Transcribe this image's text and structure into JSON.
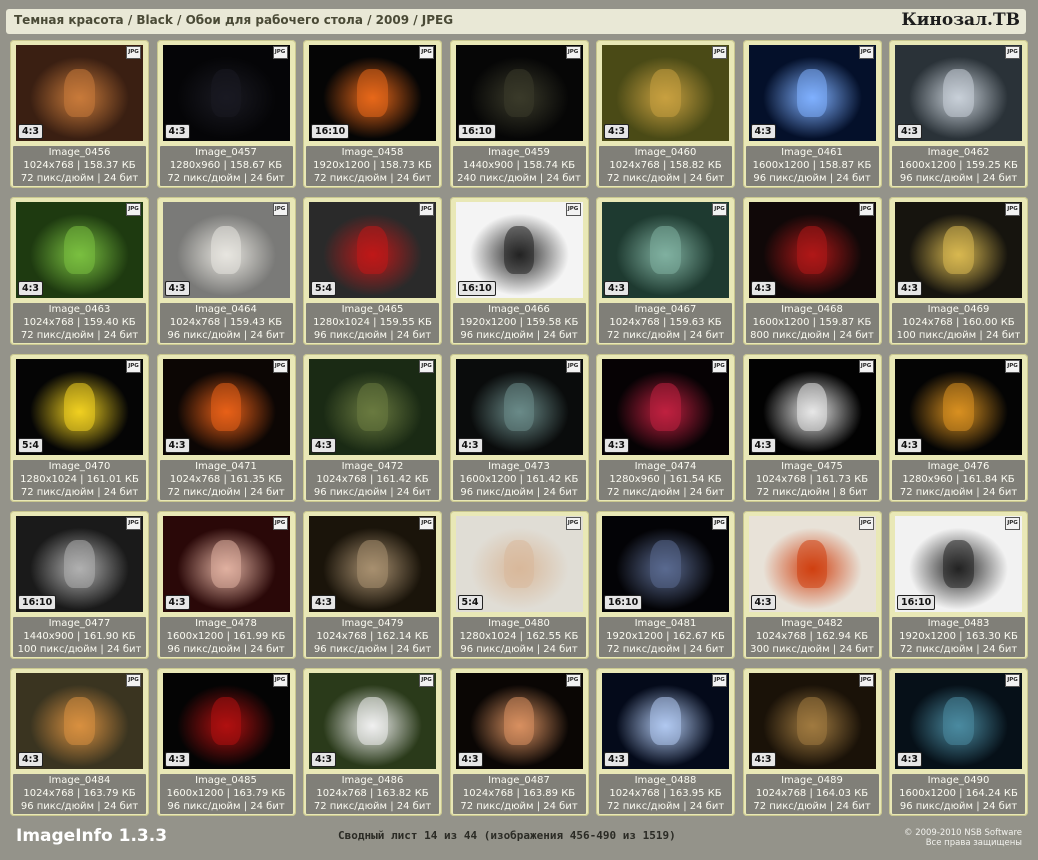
{
  "header": {
    "breadcrumb": "Темная красота / Black / Обои для рабочего стола / 2009 / JPEG",
    "logo": "Кинозал.ТВ"
  },
  "cards": [
    {
      "ratio": "4:3",
      "name": "Image_0456",
      "line2": "1024x768 | 158.37 КБ",
      "line3": "72 пикс/дюйм | 24 бит",
      "tone": "#3a1f12",
      "accent": "#c87a3a",
      "icon": "portrait"
    },
    {
      "ratio": "4:3",
      "name": "Image_0457",
      "line2": "1280x960 | 158.67 КБ",
      "line3": "72 пикс/дюйм | 24 бит",
      "tone": "#050507",
      "accent": "#1a1a22",
      "icon": "car-dark"
    },
    {
      "ratio": "16:10",
      "name": "Image_0458",
      "line2": "1920x1200 | 158.73 КБ",
      "line3": "72 пикс/дюйм | 24 бит",
      "tone": "#050505",
      "accent": "#e8681a",
      "icon": "pumpkins"
    },
    {
      "ratio": "16:10",
      "name": "Image_0459",
      "line2": "1440x900 | 158.74 КБ",
      "line3": "240 пикс/дюйм | 24 бит",
      "tone": "#060606",
      "accent": "#3a3a2a",
      "icon": "panther"
    },
    {
      "ratio": "4:3",
      "name": "Image_0460",
      "line2": "1024x768 | 158.82 КБ",
      "line3": "72 пикс/дюйм | 24 бит",
      "tone": "#4a4a16",
      "accent": "#c8a040",
      "icon": "fantasy"
    },
    {
      "ratio": "4:3",
      "name": "Image_0461",
      "line2": "1600x1200 | 158.87 КБ",
      "line3": "96 пикс/дюйм | 24 бит",
      "tone": "#04102a",
      "accent": "#7fb0ff",
      "icon": "planet"
    },
    {
      "ratio": "4:3",
      "name": "Image_0462",
      "line2": "1600x1200 | 159.25 КБ",
      "line3": "96 пикс/дюйм | 24 бит",
      "tone": "#2a3238",
      "accent": "#c8d0d8",
      "icon": "chess"
    },
    {
      "ratio": "4:3",
      "name": "Image_0463",
      "line2": "1024x768 | 159.40 КБ",
      "line3": "72 пикс/дюйм | 24 бит",
      "tone": "#1e3a10",
      "accent": "#7ac040",
      "icon": "demon"
    },
    {
      "ratio": "4:3",
      "name": "Image_0464",
      "line2": "1024x768 | 159.43 КБ",
      "line3": "96 пикс/дюйм | 24 бит",
      "tone": "#7a7a78",
      "accent": "#e8e6e0",
      "icon": "car-white"
    },
    {
      "ratio": "5:4",
      "name": "Image_0465",
      "line2": "1280x1024 | 159.55 КБ",
      "line3": "96 пикс/дюйм | 24 бит",
      "tone": "#2a2a2a",
      "accent": "#c01818",
      "icon": "woman-red"
    },
    {
      "ratio": "16:10",
      "name": "Image_0466",
      "line2": "1920x1200 | 159.58 КБ",
      "line3": "96 пикс/дюйм | 24 бит",
      "tone": "#f4f4f4",
      "accent": "#222222",
      "icon": "face",
      "light": true
    },
    {
      "ratio": "4:3",
      "name": "Image_0467",
      "line2": "1024x768 | 159.63 КБ",
      "line3": "72 пикс/дюйм | 24 бит",
      "tone": "#1e3a30",
      "accent": "#80b0a0",
      "icon": "helicopter"
    },
    {
      "ratio": "4:3",
      "name": "Image_0468",
      "line2": "1600x1200 | 159.87 КБ",
      "line3": "800 пикс/дюйм | 24 бит",
      "tone": "#100808",
      "accent": "#b01818",
      "icon": "fantasy-red"
    },
    {
      "ratio": "4:3",
      "name": "Image_0469",
      "line2": "1024x768 | 160.00 КБ",
      "line3": "100 пикс/дюйм | 24 бит",
      "tone": "#16140e",
      "accent": "#d8b850",
      "icon": "spaceship"
    },
    {
      "ratio": "5:4",
      "name": "Image_0470",
      "line2": "1280x1024 | 161.01 КБ",
      "line3": "72 пикс/дюйм | 24 бит",
      "tone": "#050505",
      "accent": "#f0d020",
      "icon": "robot"
    },
    {
      "ratio": "4:3",
      "name": "Image_0471",
      "line2": "1024x768 | 161.35 КБ",
      "line3": "72 пикс/дюйм | 24 бит",
      "tone": "#0c0604",
      "accent": "#e86018",
      "icon": "explosion"
    },
    {
      "ratio": "4:3",
      "name": "Image_0472",
      "line2": "1024x768 | 161.42 КБ",
      "line3": "96 пикс/дюйм | 24 бит",
      "tone": "#1a2a14",
      "accent": "#6a7a40",
      "icon": "monkeys"
    },
    {
      "ratio": "4:3",
      "name": "Image_0473",
      "line2": "1600x1200 | 161.42 КБ",
      "line3": "96 пикс/дюйм | 24 бит",
      "tone": "#0a0c0c",
      "accent": "#6a8a88",
      "icon": "creature"
    },
    {
      "ratio": "4:3",
      "name": "Image_0474",
      "line2": "1280x960 | 161.54 КБ",
      "line3": "72 пикс/дюйм | 24 бит",
      "tone": "#060204",
      "accent": "#c02040",
      "icon": "fairy-red"
    },
    {
      "ratio": "4:3",
      "name": "Image_0475",
      "line2": "1024x768 | 161.73 КБ",
      "line3": "72 пикс/дюйм | 8 бит",
      "tone": "#020202",
      "accent": "#e8e8e8",
      "icon": "emblem"
    },
    {
      "ratio": "4:3",
      "name": "Image_0476",
      "line2": "1280x960 | 161.84 КБ",
      "line3": "72 пикс/дюйм | 24 бит",
      "tone": "#040404",
      "accent": "#d89020",
      "icon": "dragonfly"
    },
    {
      "ratio": "16:10",
      "name": "Image_0477",
      "line2": "1440x900 | 161.90 КБ",
      "line3": "100 пикс/дюйм | 24 бит",
      "tone": "#1a1a1a",
      "accent": "#b0b0b0",
      "icon": "letter-x"
    },
    {
      "ratio": "4:3",
      "name": "Image_0478",
      "line2": "1600x1200 | 161.99 КБ",
      "line3": "96 пикс/дюйм | 24 бит",
      "tone": "#2a0808",
      "accent": "#e0b0a0",
      "icon": "woman-dark"
    },
    {
      "ratio": "4:3",
      "name": "Image_0479",
      "line2": "1024x768 | 162.14 КБ",
      "line3": "96 пикс/дюйм | 24 бит",
      "tone": "#1a140a",
      "accent": "#a89070",
      "icon": "koala"
    },
    {
      "ratio": "5:4",
      "name": "Image_0480",
      "line2": "1280x1024 | 162.55 КБ",
      "line3": "96 пикс/дюйм | 24 бит",
      "tone": "#e0ddd5",
      "accent": "#d8b89a",
      "icon": "woman-light",
      "light": true
    },
    {
      "ratio": "16:10",
      "name": "Image_0481",
      "line2": "1920x1200 | 162.67 КБ",
      "line3": "72 пикс/дюйм | 24 бит",
      "tone": "#030306",
      "accent": "#5a6a90",
      "icon": "night-ship"
    },
    {
      "ratio": "4:3",
      "name": "Image_0482",
      "line2": "1024x768 | 162.94 КБ",
      "line3": "300 пикс/дюйм | 24 бит",
      "tone": "#e8e2d8",
      "accent": "#d04010",
      "icon": "fire-demon",
      "light": true
    },
    {
      "ratio": "16:10",
      "name": "Image_0483",
      "line2": "1920x1200 | 163.30 КБ",
      "line3": "72 пикс/дюйм | 24 бит",
      "tone": "#f2f2f2",
      "accent": "#222222",
      "icon": "mug",
      "light": true
    },
    {
      "ratio": "4:3",
      "name": "Image_0484",
      "line2": "1024x768 | 163.79 КБ",
      "line3": "96 пикс/дюйм | 24 бит",
      "tone": "#3a3420",
      "accent": "#d89040",
      "icon": "tiger"
    },
    {
      "ratio": "4:3",
      "name": "Image_0485",
      "line2": "1600x1200 | 163.79 КБ",
      "line3": "96 пикс/дюйм | 24 бит",
      "tone": "#040404",
      "accent": "#b01010",
      "icon": "vampire"
    },
    {
      "ratio": "4:3",
      "name": "Image_0486",
      "line2": "1024x768 | 163.82 КБ",
      "line3": "72 пикс/дюйм | 24 бит",
      "tone": "#2a3a1a",
      "accent": "#f0f0f0",
      "icon": "dog"
    },
    {
      "ratio": "4:3",
      "name": "Image_0487",
      "line2": "1024x768 | 163.89 КБ",
      "line3": "72 пикс/дюйм | 24 бит",
      "tone": "#0a0604",
      "accent": "#d89060",
      "icon": "lizard"
    },
    {
      "ratio": "4:3",
      "name": "Image_0488",
      "line2": "1024x768 | 163.95 КБ",
      "line3": "72 пикс/дюйм | 24 бит",
      "tone": "#040a1a",
      "accent": "#b0c8f0",
      "icon": "angel"
    },
    {
      "ratio": "4:3",
      "name": "Image_0489",
      "line2": "1024x768 | 164.03 КБ",
      "line3": "72 пикс/дюйм | 24 бит",
      "tone": "#1a1208",
      "accent": "#a07a40",
      "icon": "warrior"
    },
    {
      "ratio": "4:3",
      "name": "Image_0490",
      "line2": "1600x1200 | 164.24 КБ",
      "line3": "96 пикс/дюйм | 24 бит",
      "tone": "#061018",
      "accent": "#4a8aa0",
      "icon": "abstract-blue"
    }
  ],
  "jpg_badge": "JPG",
  "footer": {
    "app_title": "ImageInfo 1.3.3",
    "summary": "Сводный лист 14 из 44 (изображения 456-490 из 1519)",
    "copyright": "© 2009-2010 NSB Software",
    "rights": "Все права защищены"
  }
}
